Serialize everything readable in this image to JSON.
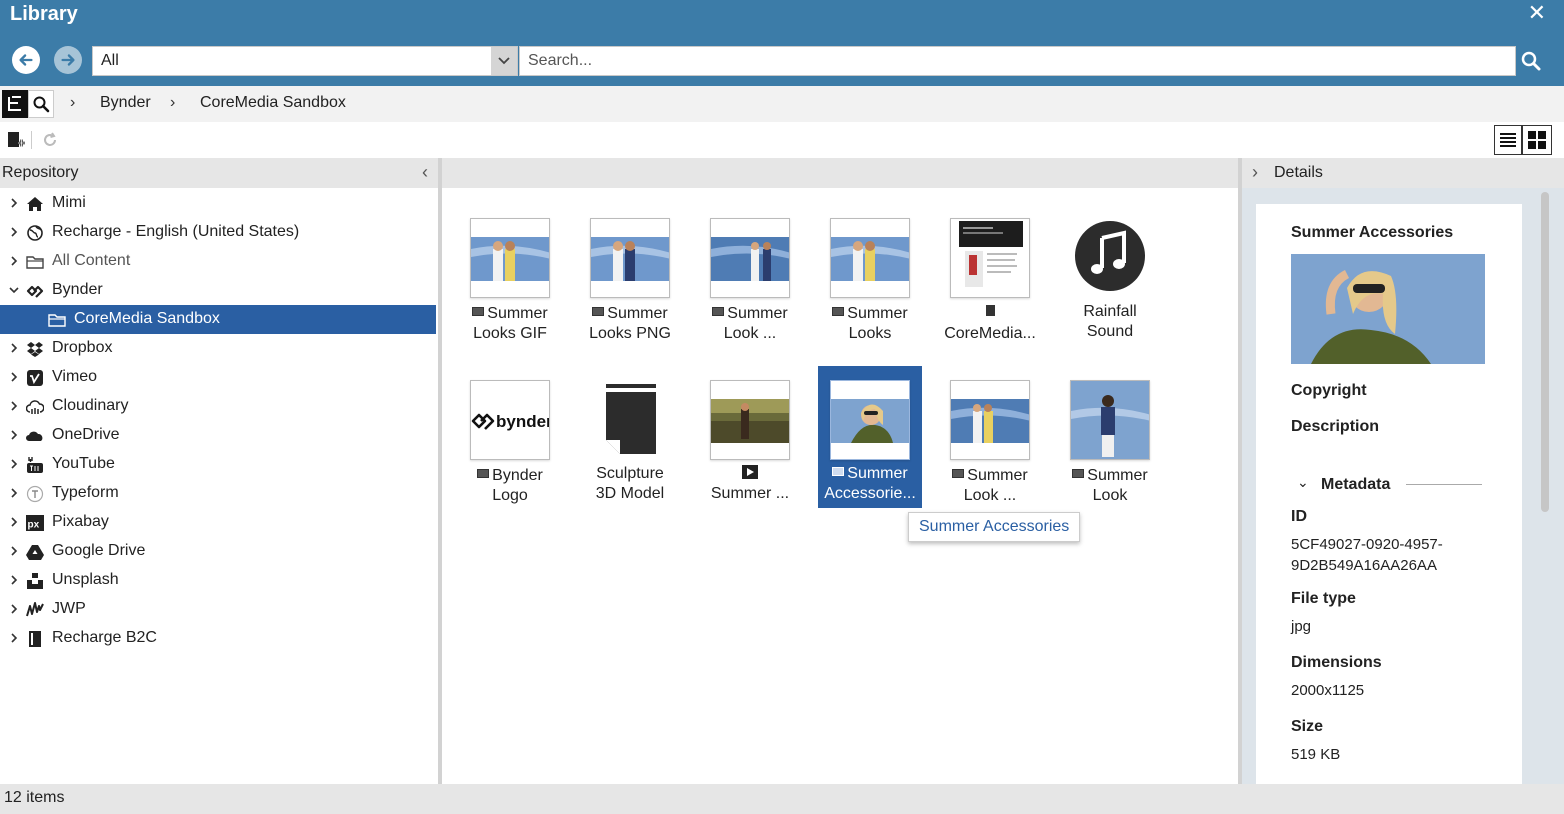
{
  "window": {
    "title": "Library"
  },
  "search": {
    "scope_value": "All",
    "placeholder": "Search..."
  },
  "breadcrumb": [
    "Bynder",
    "CoreMedia Sandbox"
  ],
  "panels": {
    "repository": "Repository",
    "details": "Details"
  },
  "tree": [
    {
      "label": "Mimi",
      "icon": "home-icon",
      "chevron": ">"
    },
    {
      "label": "Recharge - English (United States)",
      "icon": "globe-icon",
      "chevron": ">"
    },
    {
      "label": "All Content",
      "icon": "folder-icon",
      "chevron": ">"
    },
    {
      "label": "Bynder",
      "icon": "bynder-icon",
      "chevron": "v"
    },
    {
      "label": "CoreMedia Sandbox",
      "icon": "folder-icon",
      "chevron": ""
    },
    {
      "label": "Dropbox",
      "icon": "dropbox-icon",
      "chevron": ">"
    },
    {
      "label": "Vimeo",
      "icon": "vimeo-icon",
      "chevron": ">"
    },
    {
      "label": "Cloudinary",
      "icon": "cloudinary-icon",
      "chevron": ">"
    },
    {
      "label": "OneDrive",
      "icon": "onedrive-icon",
      "chevron": ">"
    },
    {
      "label": "YouTube",
      "icon": "youtube-icon",
      "chevron": ">"
    },
    {
      "label": "Typeform",
      "icon": "typeform-icon",
      "chevron": ">"
    },
    {
      "label": "Pixabay",
      "icon": "pixabay-icon",
      "chevron": ">"
    },
    {
      "label": "Google Drive",
      "icon": "google-drive-icon",
      "chevron": ">"
    },
    {
      "label": "Unsplash",
      "icon": "unsplash-icon",
      "chevron": ">"
    },
    {
      "label": "JWP",
      "icon": "jwp-icon",
      "chevron": ">"
    },
    {
      "label": "Recharge B2C",
      "icon": "book-icon",
      "chevron": ">"
    }
  ],
  "grid": [
    {
      "line1": "Summer",
      "line2": "Looks GIF",
      "type": "image",
      "thumb": "two-women"
    },
    {
      "line1": "Summer",
      "line2": "Looks PNG",
      "type": "image",
      "thumb": "two-women"
    },
    {
      "line1": "Summer",
      "line2": "Look ...",
      "type": "image",
      "thumb": "two-women"
    },
    {
      "line1": "Summer",
      "line2": "Looks",
      "type": "image",
      "thumb": "two-women"
    },
    {
      "line1": "",
      "line2": "CoreMedia...",
      "type": "document",
      "thumb": "document"
    },
    {
      "line1": "Rainfall",
      "line2": "Sound",
      "type": "audio",
      "thumb": "music-note"
    },
    {
      "line1": "Bynder",
      "line2": "Logo",
      "type": "image",
      "thumb": "bynder-logo"
    },
    {
      "line1": "Sculpture",
      "line2": "3D Model",
      "type": "model",
      "thumb": "3d-model"
    },
    {
      "line1": "",
      "line2": "Summer ...",
      "type": "video",
      "thumb": "forest-walk"
    },
    {
      "line1": "Summer",
      "line2": "Accessorie...",
      "type": "image",
      "thumb": "woman-sunglasses"
    },
    {
      "line1": "Summer",
      "line2": "Look ...",
      "type": "image",
      "thumb": "two-women"
    },
    {
      "line1": "Summer",
      "line2": "Look",
      "type": "image",
      "thumb": "woman-standing"
    }
  ],
  "tooltip": "Summer Accessories",
  "details": {
    "title": "Summer Accessories",
    "copyright_label": "Copyright",
    "description_label": "Description",
    "metadata_label": "Metadata",
    "id_label": "ID",
    "id_value_1": "5CF49027-0920-4957-",
    "id_value_2": "9D2B549A16AA26AA",
    "filetype_label": "File type",
    "filetype_value": "jpg",
    "dimensions_label": "Dimensions",
    "dimensions_value": "2000x1125",
    "size_label": "Size",
    "size_value": "519 KB"
  },
  "status": {
    "items": "12 items"
  },
  "colors": {
    "header": "#3c7ca8",
    "selection": "#2a5fa3"
  }
}
